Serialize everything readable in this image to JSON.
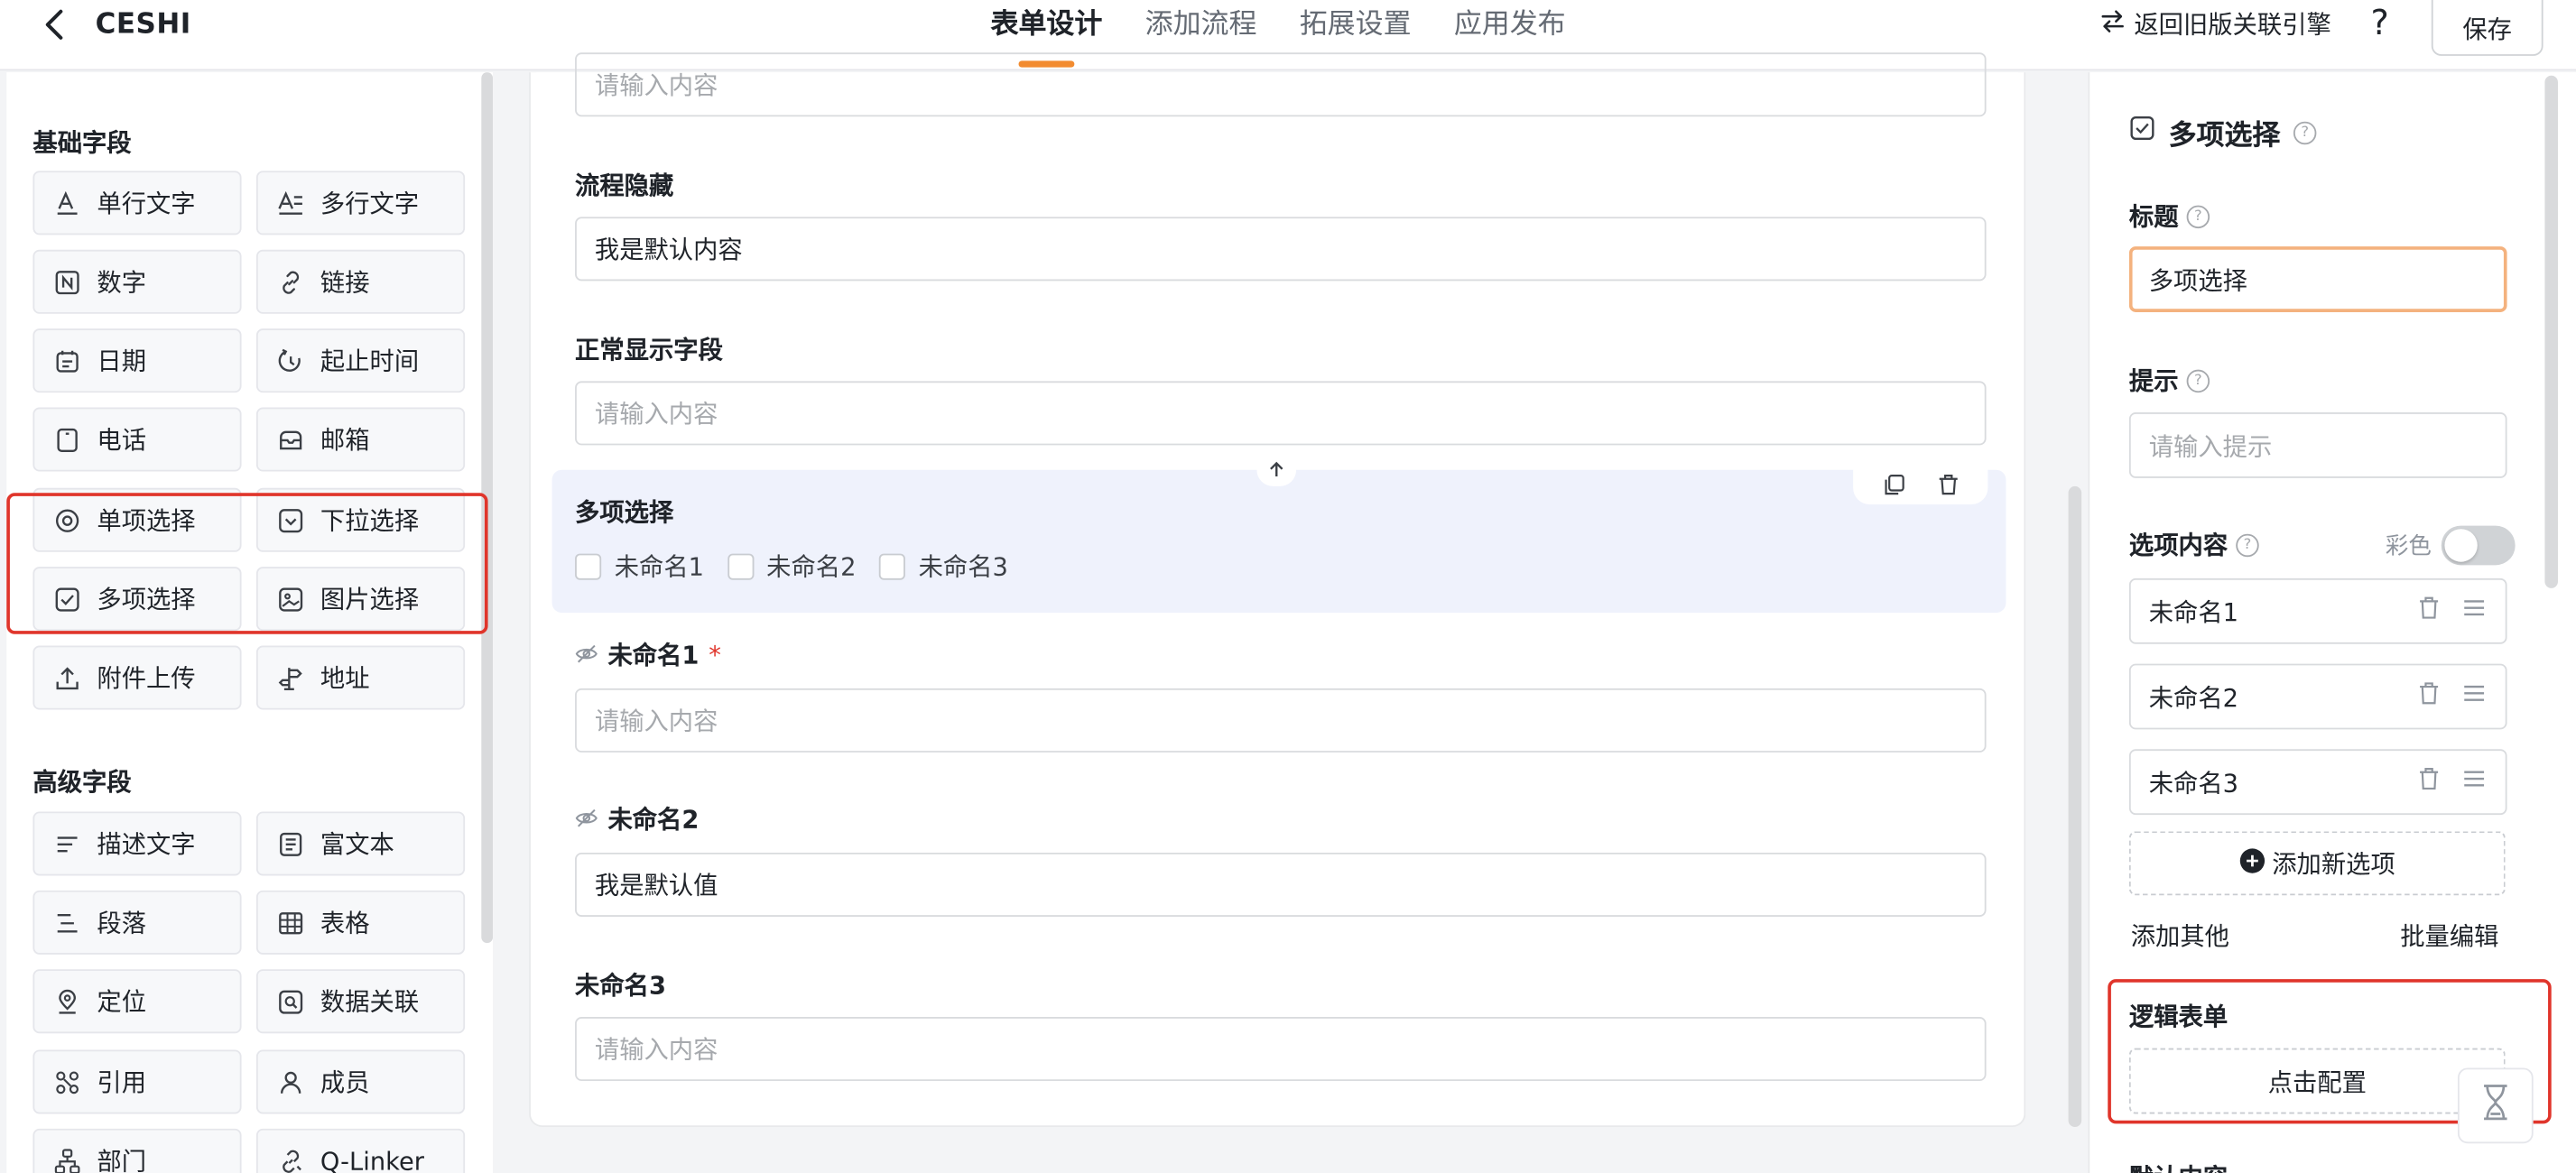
{
  "header": {
    "app_title": "CESHI",
    "tabs": [
      "表单设计",
      "添加流程",
      "拓展设置",
      "应用发布"
    ],
    "active_tab": "表单设计",
    "legacy_link": "返回旧版关联引擎",
    "help": "?",
    "save_label": "保存"
  },
  "left_panel": {
    "basic_group": {
      "title": "基础字段",
      "items": [
        "单行文字",
        "多行文字",
        "数字",
        "链接",
        "日期",
        "起止时间",
        "电话",
        "邮箱",
        "单项选择",
        "下拉选择",
        "多项选择",
        "图片选择",
        "附件上传",
        "地址"
      ]
    },
    "advanced_group": {
      "title": "高级字段",
      "items": [
        "描述文字",
        "富文本",
        "段落",
        "表格",
        "定位",
        "数据关联",
        "引用",
        "成员",
        "部门",
        "Q-Linker"
      ]
    }
  },
  "canvas": {
    "top_input_placeholder": "请输入内容",
    "fields": [
      {
        "label": "流程隐藏",
        "value": "我是默认内容",
        "placeholder": ""
      },
      {
        "label": "正常显示字段",
        "value": "",
        "placeholder": "请输入内容"
      }
    ],
    "selected_field": {
      "label": "多项选择",
      "options": [
        "未命名1",
        "未命名2",
        "未命名3"
      ]
    },
    "fields_after": [
      {
        "label": "未命名1",
        "required_mark": "*",
        "value": "",
        "placeholder": "请输入内容"
      },
      {
        "label": "未命名2",
        "required_mark": "",
        "value": "我是默认值",
        "placeholder": ""
      },
      {
        "label": "未命名3",
        "required_mark": "",
        "value": "",
        "placeholder": "请输入内容"
      }
    ]
  },
  "right_panel": {
    "component_title": "多项选择",
    "title_label": "标题",
    "title_value": "多项选择",
    "hint_label": "提示",
    "hint_placeholder": "请输入提示",
    "options_label": "选项内容",
    "color_label": "彩色",
    "color_enabled": false,
    "options": [
      "未命名1",
      "未命名2",
      "未命名3"
    ],
    "add_option": "添加新选项",
    "add_other": "添加其他",
    "batch_edit": "批量编辑",
    "logic_label": "逻辑表单",
    "logic_button": "点击配置",
    "default_label": "默认内容"
  },
  "colors": {
    "accent": "#f28b2f",
    "highlight_box": "#e0352b",
    "selected_card_bg": "#eff2fc"
  }
}
